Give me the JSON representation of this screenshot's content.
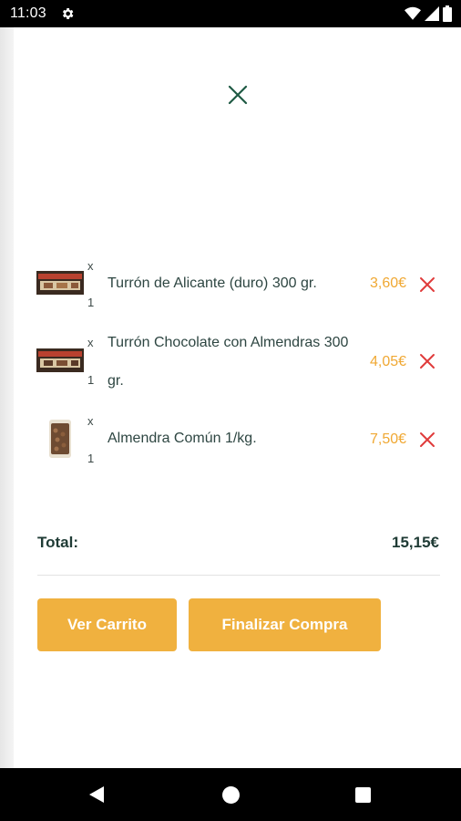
{
  "status_bar": {
    "time": "11:03",
    "icons": [
      "gear-icon",
      "wifi-icon",
      "cell-signal-icon",
      "battery-icon"
    ]
  },
  "drawer": {
    "close_icon": "close-icon"
  },
  "cart": {
    "items": [
      {
        "qty_prefix": "x",
        "qty": "1",
        "name": "Turrón de Alicante (duro) 300 gr.",
        "price": "3,60€",
        "thumb": "turron-box-thumbnail"
      },
      {
        "qty_prefix": "x",
        "qty": "1",
        "name": "Turrón Chocolate con Almendras 300 gr.",
        "price": "4,05€",
        "thumb": "turron-box-thumbnail"
      },
      {
        "qty_prefix": "x",
        "qty": "1",
        "name": "Almendra Común 1/kg.",
        "price": "7,50€",
        "thumb": "almond-bag-thumbnail"
      }
    ],
    "total_label": "Total:",
    "total_value": "15,15€"
  },
  "actions": {
    "view_cart_label": "Ver Carrito",
    "checkout_label": "Finalizar Compra"
  },
  "colors": {
    "accent": "#f0b13f",
    "price": "#f0a833",
    "remove": "#e03b3b",
    "text": "#2e4642",
    "close": "#1f5a44"
  }
}
